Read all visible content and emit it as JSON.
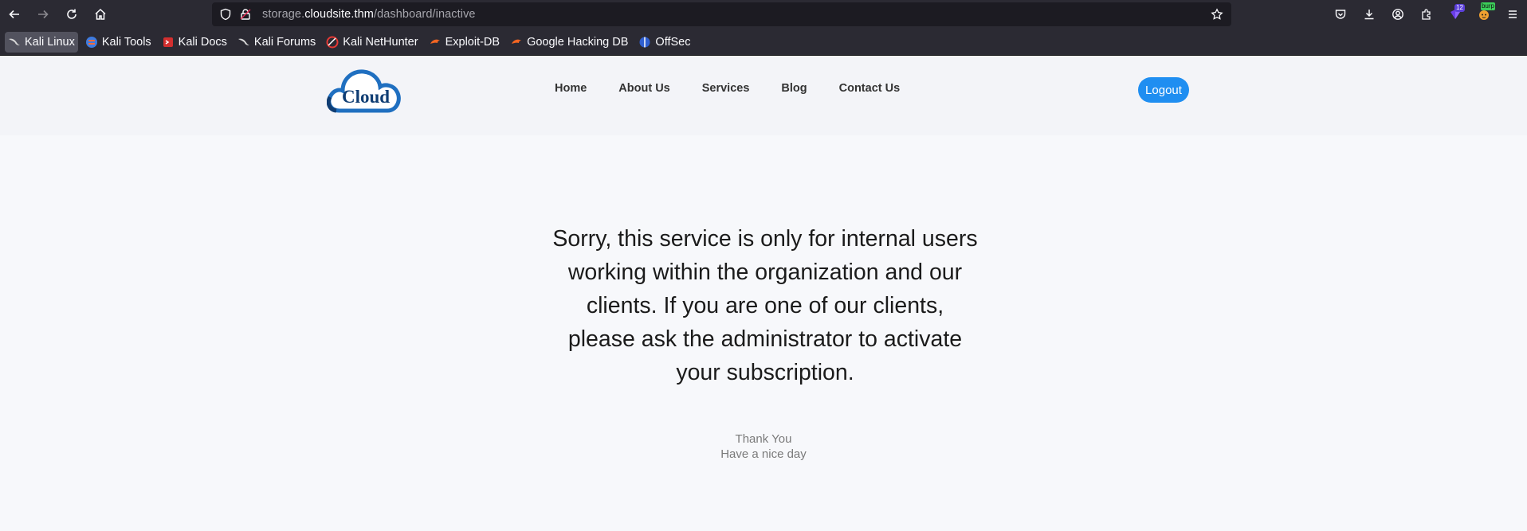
{
  "browser": {
    "url_prefix": "storage.",
    "url_host": "cloudsite.thm",
    "url_path": "/dashboard/inactive",
    "extension_badge": "12",
    "burp_label": "burp"
  },
  "bookmarks": [
    {
      "label": "Kali Linux",
      "icon": "kali-dragon-icon"
    },
    {
      "label": "Kali Tools",
      "icon": "kali-tools-icon"
    },
    {
      "label": "Kali Docs",
      "icon": "kali-docs-icon"
    },
    {
      "label": "Kali Forums",
      "icon": "kali-dragon-icon"
    },
    {
      "label": "Kali NetHunter",
      "icon": "nethunter-icon"
    },
    {
      "label": "Exploit-DB",
      "icon": "exploit-db-icon"
    },
    {
      "label": "Google Hacking DB",
      "icon": "exploit-db-icon"
    },
    {
      "label": "OffSec",
      "icon": "offsec-icon"
    }
  ],
  "site": {
    "logo_text": "Cloud",
    "nav": [
      "Home",
      "About Us",
      "Services",
      "Blog",
      "Contact Us"
    ],
    "logout_label": "Logout",
    "message": "Sorry, this service is only for internal users working within the organization and our clients. If you are one of our clients, please ask the administrator to activate your subscription.",
    "thanks_line1": "Thank You",
    "thanks_line2": "Have a nice day"
  },
  "colors": {
    "chrome_bg": "#2b2a33",
    "urlbar_bg": "#1c1b22",
    "page_bg": "#f7f8fb",
    "header_bg": "#f3f4f8",
    "accent": "#1f8ef1",
    "logo_blue": "#1f6fc0",
    "logo_navy": "#0f3d73"
  }
}
